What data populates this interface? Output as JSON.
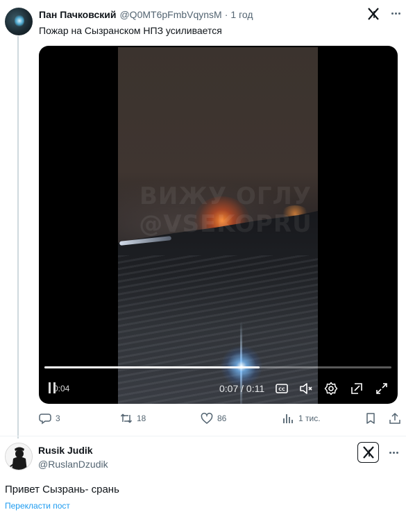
{
  "post1": {
    "author_name": "Пан Пачковский",
    "author_handle": "@Q0MT6pFmbVqynsM",
    "separator": "·",
    "timestamp": "1 год",
    "text": "Пожар на Сызранском НПЗ усиливается",
    "video": {
      "elapsed_label": "0:04",
      "timecode": "0:07 / 0:11",
      "progress": 0.62,
      "watermark": "ВИЖУ ОГЛУ\n@VSEKOPRU"
    },
    "actions": {
      "replies": "3",
      "reposts": "18",
      "likes": "86",
      "views": "1 тис."
    }
  },
  "post2": {
    "author_name": "Rusik Judik",
    "author_handle": "@RuslanDzudik",
    "text": "Привет Сызрань- срань",
    "translate_label": "Перекласти пост"
  },
  "colors": {
    "text_primary": "#0f1419",
    "text_secondary": "#536471",
    "link": "#1d9bf0"
  },
  "icons": [
    "x-logo-icon",
    "more-icon",
    "pause-icon",
    "captions-icon",
    "mute-icon",
    "settings-icon",
    "popout-icon",
    "fullscreen-icon",
    "reply-icon",
    "repost-icon",
    "like-icon",
    "views-icon",
    "bookmark-icon",
    "share-icon"
  ]
}
